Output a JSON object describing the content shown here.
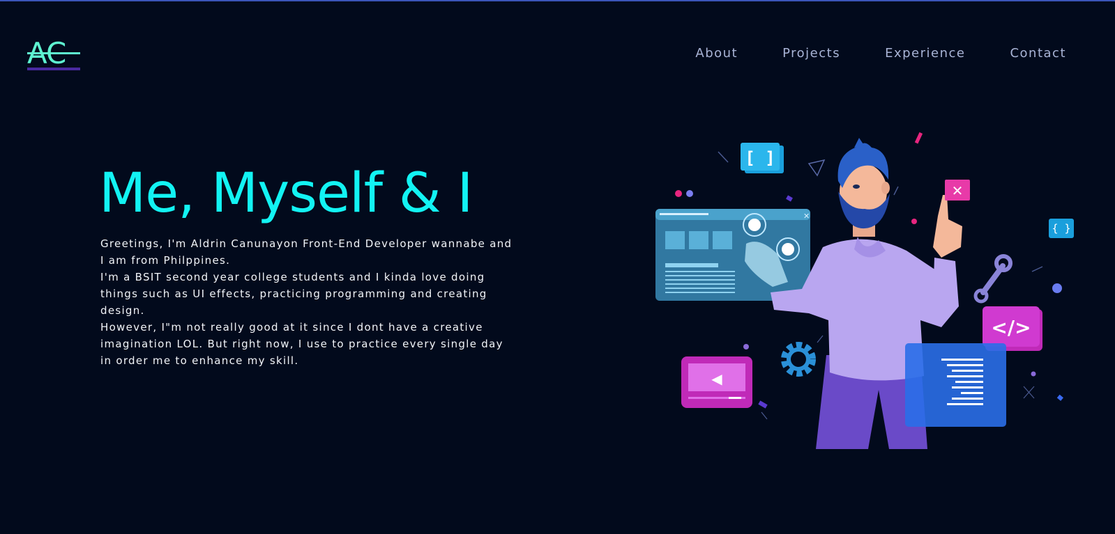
{
  "logo": {
    "text": "AC"
  },
  "nav": {
    "items": [
      {
        "label": "About"
      },
      {
        "label": "Projects"
      },
      {
        "label": "Experience"
      },
      {
        "label": "Contact"
      }
    ]
  },
  "hero": {
    "title": "Me, Myself & I",
    "paragraphs": [
      "Greetings, I'm Aldrin Canunayon Front-End Developer wannabe and I am from Philppines.",
      "I'm a BSIT second year college students and I kinda love doing things such as UI effects, practicing programming and creating design.",
      "However, I\"m not really good at it since I dont have a creative imagination LOL. But right now, I use to practice every single day in order me to enhance my skill."
    ]
  },
  "illustration": {
    "bracket_icon_text": "[ ]",
    "small_bracket_icon_text": "{ }",
    "code_icon_text": "</>",
    "close_icon_text": "✕",
    "play_icon_text": "◀"
  },
  "colors": {
    "background": "#020a1c",
    "accent": "#12f3f3",
    "logo": "#5ef2d0",
    "nav_text": "#a9b4d6"
  }
}
